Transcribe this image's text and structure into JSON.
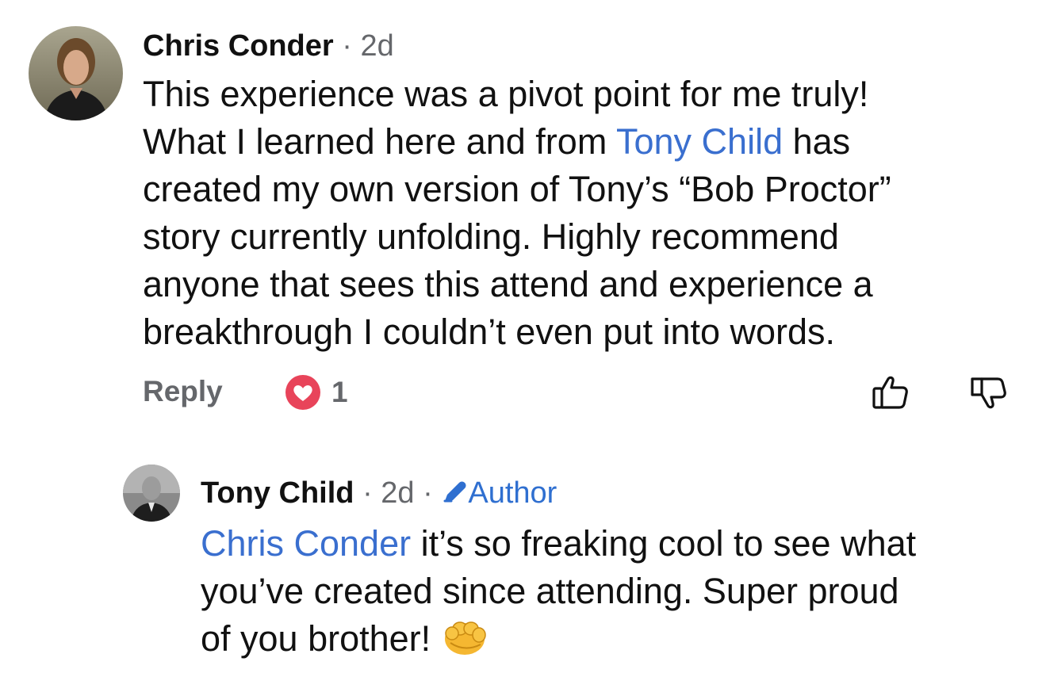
{
  "comments": [
    {
      "author": "Chris Conder",
      "separator": "·",
      "time": "2d",
      "text_parts": {
        "l1": "This experience was a pivot point for me truly!",
        "l2a": "What I learned here and from ",
        "l2_mention": "Tony Child",
        "l2b": " has",
        "l3": "created my own version of Tony’s “Bob Proctor”",
        "l4": "story currently unfolding. Highly recommend",
        "l5": "anyone that sees this attend and experience a",
        "l6": "breakthrough I couldn’t even put into words."
      },
      "reply_label": "Reply",
      "reaction": {
        "type": "heart",
        "count": "1",
        "color": "#e8445a"
      },
      "like_icon": "thumbs-up-icon",
      "dislike_icon": "thumbs-down-icon"
    }
  ],
  "reply": {
    "author": "Tony Child",
    "separator": "·",
    "time": "2d",
    "separator2": "·",
    "badge": "Author",
    "badge_icon": "pencil-icon",
    "text_parts": {
      "mention": "Chris Conder",
      "l1": " it’s so freaking cool to see what",
      "l2": "you’ve created since attending. Super proud",
      "l3": "of you brother! "
    },
    "emoji": "fist-bump-emoji"
  },
  "colors": {
    "link": "#3a6fcf",
    "meta": "#65676b",
    "heart": "#e8445a"
  }
}
